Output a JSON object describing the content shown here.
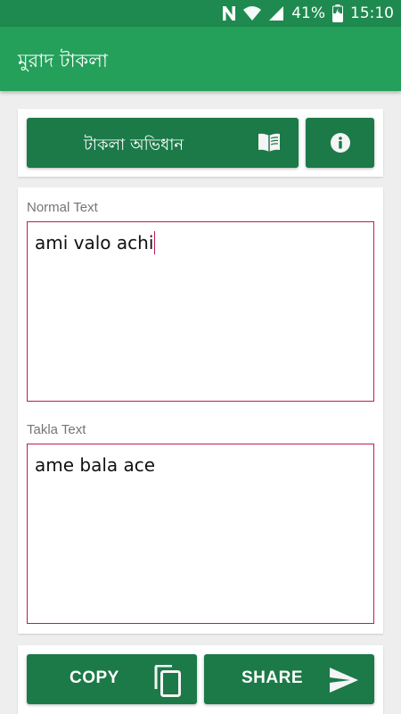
{
  "status_bar": {
    "battery": "41%",
    "time": "15:10",
    "icons": [
      "n-icon",
      "wifi-icon",
      "signal-icon",
      "battery-icon"
    ]
  },
  "app_bar": {
    "title": "মুরাদ টাকলা"
  },
  "toolbar": {
    "dictionary_label": "টাকলা অভিধান",
    "dictionary_icon": "book-icon",
    "info_icon": "info-icon"
  },
  "editor": {
    "normal_label": "Normal Text",
    "normal_value": "ami valo achi",
    "takla_label": "Takla Text",
    "takla_value": "ame bala ace"
  },
  "actions": {
    "copy_label": "COPY",
    "copy_icon": "copy-icon",
    "share_label": "SHARE",
    "share_icon": "send-icon"
  },
  "colors": {
    "status_bar": "#1e8a4f",
    "app_bar": "#24a05b",
    "button": "#1b7a48",
    "field_border": "#c2185b",
    "background": "#eeeeee"
  }
}
